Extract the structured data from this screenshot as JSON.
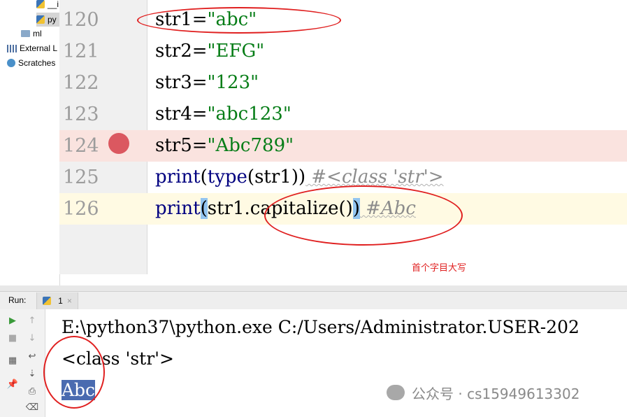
{
  "sidebar": {
    "items": [
      {
        "label": "__i"
      },
      {
        "label": "py"
      },
      {
        "label": "ml"
      },
      {
        "label": "External L"
      },
      {
        "label": "Scratches"
      }
    ]
  },
  "editor": {
    "lines": [
      {
        "num": "120",
        "parts": [
          "str1=",
          "\"abc\""
        ]
      },
      {
        "num": "121",
        "parts": [
          "str2=",
          "\"EFG\""
        ]
      },
      {
        "num": "122",
        "parts": [
          "str3=",
          "\"123\""
        ]
      },
      {
        "num": "123",
        "parts": [
          "str4=",
          "\"abc123\""
        ]
      },
      {
        "num": "124",
        "parts": [
          "str5=",
          "\"Abc789\""
        ]
      },
      {
        "num": "125",
        "parts": [
          "print",
          "(",
          "type",
          "(str1))",
          " #<class 'str'>"
        ]
      },
      {
        "num": "126",
        "parts": [
          "print",
          "(",
          "str1.capitalize()",
          ")",
          " #Abc"
        ]
      }
    ],
    "annotation": "首个字目大写"
  },
  "run": {
    "label": "Run:",
    "tab_label": "1",
    "tab_close": "×",
    "console": [
      "E:\\python37\\python.exe C:/Users/Administrator.USER-202",
      "<class 'str'>",
      "Abc"
    ]
  },
  "watermark": {
    "text": "公众号 · cs15949613302"
  },
  "colors": {
    "breakpoint": "#db5860",
    "string": "#067d17",
    "builtin": "#000080",
    "annotation": "#e02020"
  }
}
